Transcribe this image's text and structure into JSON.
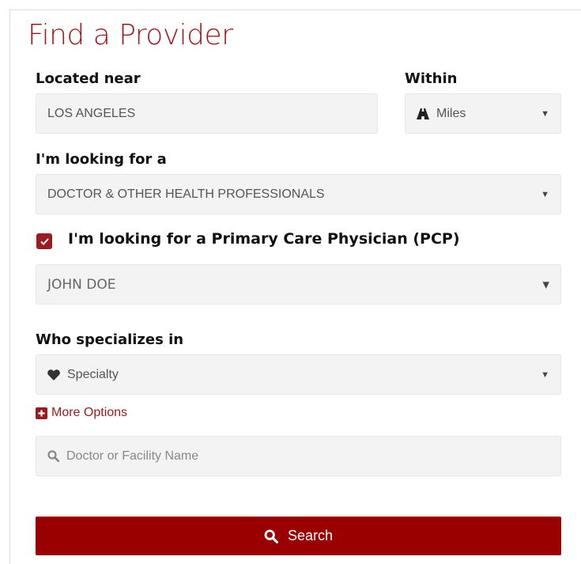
{
  "title": "Find a Provider",
  "location": {
    "label": "Located near",
    "value": "LOS ANGELES"
  },
  "distance": {
    "label": "Within",
    "value": "Miles",
    "icon": "road-icon"
  },
  "provider_type": {
    "label": "I'm looking for a",
    "value": "DOCTOR & OTHER HEALTH PROFESSIONALS"
  },
  "pcp": {
    "checked": true,
    "label": "I'm looking for a Primary Care Physician (PCP)",
    "member_value": "JOHN DOE"
  },
  "specialty": {
    "label": "Who specializes in",
    "value": "Specialty",
    "icon": "heart-icon"
  },
  "more_options": {
    "label": "More Options",
    "icon": "plus-square-icon"
  },
  "name_search": {
    "placeholder": "Doctor or Facility Name",
    "icon": "search-icon"
  },
  "search_button": {
    "label": "Search",
    "icon": "search-icon"
  },
  "colors": {
    "brand": "#9b1c20",
    "button": "#9b0000",
    "field_bg": "#f3f3f3"
  }
}
